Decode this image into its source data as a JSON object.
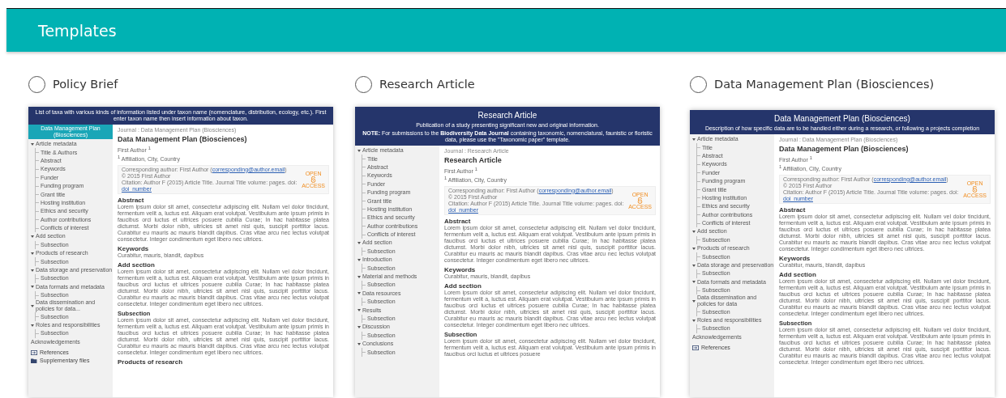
{
  "header": {
    "title": "Templates"
  },
  "templates": [
    {
      "label": "Policy Brief",
      "selected": false,
      "preview": {
        "banner": {
          "lines": [
            "List of taxa with various kinds of information listed under taxon name (nomenclature, distribution, ecology, etc.). First enter taxon name then insert information about taxon."
          ]
        },
        "sidebar_header": "Data Management Plan (Biosciences)",
        "sidebar": [
          {
            "label": "Article metadata",
            "expanded": true,
            "children": [
              {
                "label": "Title & Authors"
              },
              {
                "label": "Abstract"
              },
              {
                "label": "Keywords"
              },
              {
                "label": "Funder"
              },
              {
                "label": "Funding program"
              },
              {
                "label": "Grant title"
              },
              {
                "label": "Hosting institution"
              },
              {
                "label": "Ethics and security"
              },
              {
                "label": "Author contributions"
              },
              {
                "label": "Conflicts of interest"
              }
            ]
          },
          {
            "label": "Add section",
            "expanded": true,
            "children": [
              {
                "label": "Subsection"
              }
            ]
          },
          {
            "label": "Products of research",
            "expanded": true,
            "children": [
              {
                "label": "Subsection"
              }
            ]
          },
          {
            "label": "Data storage and preservation",
            "expanded": true,
            "children": [
              {
                "label": "Subsection"
              }
            ]
          },
          {
            "label": "Data formats and metadata",
            "expanded": true,
            "children": [
              {
                "label": "Subsection"
              }
            ]
          },
          {
            "label": "Data dissemination and policies for data...",
            "expanded": true,
            "children": [
              {
                "label": "Subsection"
              }
            ]
          },
          {
            "label": "Roles and responsibilities",
            "expanded": true,
            "children": [
              {
                "label": "Subsection"
              }
            ]
          },
          {
            "label": "Acknowledgements"
          }
        ],
        "sidebar_footer": [
          {
            "label": "References",
            "kind": "references"
          },
          {
            "label": "Supplementary files",
            "kind": "files"
          }
        ],
        "breadcrumb": "Journal : Data Management Plan (Biosciences)",
        "title": "Data Management Plan (Biosciences)",
        "author": "First Author $^{1}$",
        "affiliation": "$^{1}$ Affiliation, City, Country",
        "info": [
          {
            "text": "Corresponding author: First Author (",
            "link": "corresponding@author.email",
            "after": ")"
          },
          {
            "text": "© 2015 First Author"
          },
          {
            "text": "Citation: Author F (2015) Article Title. Journal Title volume: pages. doi: ",
            "link": "doi_number"
          }
        ],
        "badge": {
          "left": "OPEN",
          "right": "ACCESS"
        },
        "sections": [
          {
            "kind": "heading",
            "title": "Abstract",
            "text": "Lorem ipsum dolor sit amet, consectetur adipiscing elit. Nullam vel dolor tincidunt, fermentum velit a, luctus est. Aliquam erat volutpat. Vestibulum ante ipsum primis in faucibus orci luctus et ultrices posuere cubilia Curae; In hac habitasse platea dictumst. Morbi dolor nibh, ultricies sit amet nisl quis, suscipit porttitor lacus. Curabitur eu mauris ac mauris blandit dapibus. Cras vitae arcu nec lectus volutpat consectetur. Integer condimentum eget libero nec ultrices."
          },
          {
            "kind": "heading",
            "title": "Keywords",
            "text": "Curabitur, mauris, blandit, dapibus"
          },
          {
            "kind": "heading",
            "title": "Add section",
            "text": "Lorem ipsum dolor sit amet, consectetur adipiscing elit. Nullam vel dolor tincidunt, fermentum velit a, luctus est. Aliquam erat volutpat. Vestibulum ante ipsum primis in faucibus orci luctus et ultrices posuere cubilia Curae; In hac habitasse platea dictumst. Morbi dolor nibh, ultricies sit amet nisl quis, suscipit porttitor lacus. Curabitur eu mauris ac mauris blandit dapibus. Cras vitae arcu nec lectus volutpat consectetur. Integer condimentum eget libero nec ultrices."
          },
          {
            "kind": "subheading",
            "title": "Subsection",
            "text": "Lorem ipsum dolor sit amet, consectetur adipiscing elit. Nullam vel dolor tincidunt, fermentum velit a, luctus est. Aliquam erat volutpat. Vestibulum ante ipsum primis in faucibus orci luctus et ultrices posuere cubilia Curae; In hac habitasse platea dictumst. Morbi dolor nibh, ultricies sit amet nisl quis, suscipit porttitor lacus. Curabitur eu mauris ac mauris blandit dapibus. Cras vitae arcu nec lectus volutpat consectetur. Integer condimentum eget libero nec ultrices."
          },
          {
            "kind": "heading",
            "title": "Products of research"
          }
        ]
      }
    },
    {
      "label": "Research Article",
      "selected": false,
      "preview": {
        "banner": {
          "title": "Research Article",
          "lines": [
            "Publication of a study presenting significant new and original information.",
            "**NOTE:** For submissions to the **Biodiversity Data Journal** containing taxonomic, nomenclatural, faunistic or floristic data, please use the \"Taxonomic paper\" template."
          ]
        },
        "sidebar": [
          {
            "label": "Article metadata",
            "expanded": true,
            "children": [
              {
                "label": "Title"
              },
              {
                "label": "Abstract"
              },
              {
                "label": "Keywords"
              },
              {
                "label": "Funder"
              },
              {
                "label": "Funding program"
              },
              {
                "label": "Grant title"
              },
              {
                "label": "Hosting institution"
              },
              {
                "label": "Ethics and security"
              },
              {
                "label": "Author contributions"
              },
              {
                "label": "Conflicts of interest"
              }
            ]
          },
          {
            "label": "Add section",
            "expanded": true,
            "children": [
              {
                "label": "Subsection"
              }
            ]
          },
          {
            "label": "Introduction",
            "expanded": true,
            "children": [
              {
                "label": "Subsection"
              }
            ]
          },
          {
            "label": "Material and methods",
            "expanded": true,
            "children": [
              {
                "label": "Subsection"
              }
            ]
          },
          {
            "label": "Data resources",
            "expanded": true,
            "children": [
              {
                "label": "Subsection"
              }
            ]
          },
          {
            "label": "Results",
            "expanded": true,
            "children": [
              {
                "label": "Subsection"
              }
            ]
          },
          {
            "label": "Discussion",
            "expanded": true,
            "children": [
              {
                "label": "Subsection"
              }
            ]
          },
          {
            "label": "Conclusions",
            "expanded": true,
            "children": [
              {
                "label": "Subsection"
              }
            ]
          }
        ],
        "breadcrumb": "Journal : Research Article",
        "title": "Research Article",
        "author": "First Author $^{1}$",
        "affiliation": "$^{1}$ Affiliation, City, Country",
        "info": [
          {
            "text": "Corresponding author: First Author (",
            "link": "corresponding@author.email",
            "after": ")"
          },
          {
            "text": "© 2015 First Author"
          },
          {
            "text": "Citation: Author F (2015) Article Title. Journal Title volume: pages. doi: ",
            "link": "doi_number"
          }
        ],
        "badge": {
          "left": "OPEN",
          "right": "ACCESS"
        },
        "sections": [
          {
            "kind": "heading",
            "title": "Abstract",
            "text": "Lorem ipsum dolor sit amet, consectetur adipiscing elit. Nullam vel dolor tincidunt, fermentum velit a, luctus est. Aliquam erat volutpat. Vestibulum ante ipsum primis in faucibus orci luctus et ultrices posuere cubilia Curae; In hac habitasse platea dictumst. Morbi dolor nibh, ultricies sit amet nisl quis, suscipit porttitor lacus. Curabitur eu mauris ac mauris blandit dapibus. Cras vitae arcu nec lectus volutpat consectetur. Integer condimentum eget libero nec ultrices."
          },
          {
            "kind": "heading",
            "title": "Keywords",
            "text": "Curabitur, mauris, blandit, dapibus"
          },
          {
            "kind": "heading",
            "title": "Add section",
            "text": "Lorem ipsum dolor sit amet, consectetur adipiscing elit. Nullam vel dolor tincidunt, fermentum velit a, luctus est. Aliquam erat volutpat. Vestibulum ante ipsum primis in faucibus orci luctus et ultrices posuere cubilia Curae; In hac habitasse platea dictumst. Morbi dolor nibh, ultricies sit amet nisl quis, suscipit porttitor lacus. Curabitur eu mauris ac mauris blandit dapibus. Cras vitae arcu nec lectus volutpat consectetur. Integer condimentum eget libero nec ultrices."
          },
          {
            "kind": "subheading",
            "title": "Subsection",
            "text": "Lorem ipsum dolor sit amet, consectetur adipiscing elit. Nullam vel dolor tincidunt, fermentum velit a, luctus est. Aliquam erat volutpat. Vestibulum ante ipsum primis in faucibus orci luctus et ultrices posuere"
          }
        ]
      }
    },
    {
      "label": "Data Management Plan (Biosciences)",
      "selected": false,
      "preview": {
        "banner": {
          "title": "Data Management Plan (Biosciences)",
          "lines": [
            "Description of how specific data are to be handled either during a research, or following a projects completion"
          ]
        },
        "sidebar": [
          {
            "label": "Article metadata",
            "expanded": true,
            "children": [
              {
                "label": "Title"
              },
              {
                "label": "Abstract"
              },
              {
                "label": "Keywords"
              },
              {
                "label": "Funder"
              },
              {
                "label": "Funding program"
              },
              {
                "label": "Grant title"
              },
              {
                "label": "Hosting institution"
              },
              {
                "label": "Ethics and security"
              },
              {
                "label": "Author contributions"
              },
              {
                "label": "Conflicts of interest"
              }
            ]
          },
          {
            "label": "Add section",
            "expanded": true,
            "children": [
              {
                "label": "Subsection"
              }
            ]
          },
          {
            "label": "Products of research",
            "expanded": true,
            "children": [
              {
                "label": "Subsection"
              }
            ]
          },
          {
            "label": "Data storage and preservation",
            "expanded": true,
            "children": [
              {
                "label": "Subsection"
              }
            ]
          },
          {
            "label": "Data formats and metadata",
            "expanded": true,
            "children": [
              {
                "label": "Subsection"
              }
            ]
          },
          {
            "label": "Data dissemination and policies for data",
            "expanded": true,
            "children": [
              {
                "label": "Subsection"
              }
            ]
          },
          {
            "label": "Roles and responsibilities",
            "expanded": true,
            "children": [
              {
                "label": "Subsection"
              }
            ]
          },
          {
            "label": "Acknowledgements"
          }
        ],
        "sidebar_footer": [
          {
            "label": "References",
            "kind": "references"
          }
        ],
        "breadcrumb": "Journal : Data Management Plan (Biosciences)",
        "title": "Data Management Plan (Biosciences)",
        "author": "First Author $^{1}$",
        "affiliation": "$^{1}$ Affiliation, City, Country",
        "info": [
          {
            "text": "Corresponding author: First Author (",
            "link": "corresponding@author.email",
            "after": ")"
          },
          {
            "text": "© 2015 First Author"
          },
          {
            "text": "Citation: Author F (2015) Article Title. Journal Title volume: pages. doi: ",
            "link": "doi_number"
          }
        ],
        "badge": {
          "left": "OPEN",
          "right": "ACCESS"
        },
        "sections": [
          {
            "kind": "heading",
            "title": "Abstract",
            "text": "Lorem ipsum dolor sit amet, consectetur adipiscing elit. Nullam vel dolor tincidunt, fermentum velit a, luctus est. Aliquam erat volutpat. Vestibulum ante ipsum primis in faucibus orci luctus et ultrices posuere cubilia Curae; In hac habitasse platea dictumst. Morbi dolor nibh, ultricies sit amet nisl quis, suscipit porttitor lacus. Curabitur eu mauris ac mauris blandit dapibus. Cras vitae arcu nec lectus volutpat consectetur. Integer condimentum eget libero nec ultrices."
          },
          {
            "kind": "heading",
            "title": "Keywords",
            "text": "Curabitur, mauris, blandit, dapibus"
          },
          {
            "kind": "heading",
            "title": "Add section",
            "text": "Lorem ipsum dolor sit amet, consectetur adipiscing elit. Nullam vel dolor tincidunt, fermentum velit a, luctus est. Aliquam erat volutpat. Vestibulum ante ipsum primis in faucibus orci luctus et ultrices posuere cubilia Curae; In hac habitasse platea dictumst. Morbi dolor nibh, ultricies sit amet nisl quis, suscipit porttitor lacus. Curabitur eu mauris ac mauris blandit dapibus. Cras vitae arcu nec lectus volutpat consectetur. Integer condimentum eget libero nec ultrices."
          },
          {
            "kind": "subheading",
            "title": "Subsection",
            "text": "Lorem ipsum dolor sit amet, consectetur adipiscing elit. Nullam vel dolor tincidunt, fermentum velit a, luctus est. Aliquam erat volutpat. Vestibulum ante ipsum primis in faucibus orci luctus et ultrices posuere cubilia Curae; In hac habitasse platea dictumst. Morbi dolor nibh, ultricies sit amet nisl quis, suscipit porttitor lacus. Curabitur eu mauris ac mauris blandit dapibus. Cras vitae arcu nec lectus volutpat consectetur. Integer condimentum eget libero nec ultrices."
          }
        ]
      }
    }
  ]
}
